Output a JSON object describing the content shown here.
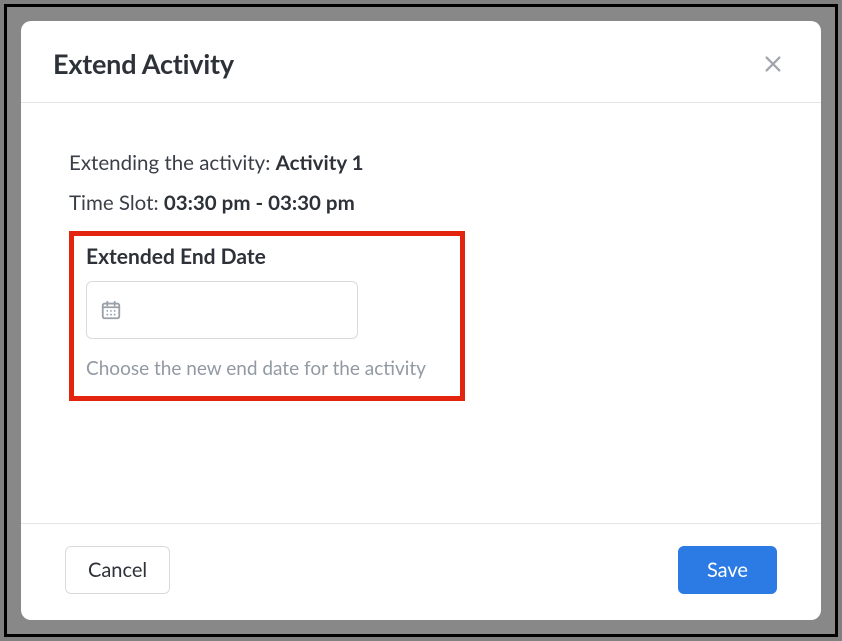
{
  "modal": {
    "title": "Extend Activity",
    "info": {
      "extending_label": "Extending the activity: ",
      "activity_name": "Activity 1",
      "time_slot_label": "Time Slot: ",
      "time_slot_value": "03:30 pm - 03:30 pm"
    },
    "field": {
      "label": "Extended End Date",
      "value": "",
      "placeholder": "",
      "help_text": "Choose the new end date for the activity"
    },
    "buttons": {
      "cancel": "Cancel",
      "save": "Save"
    }
  }
}
